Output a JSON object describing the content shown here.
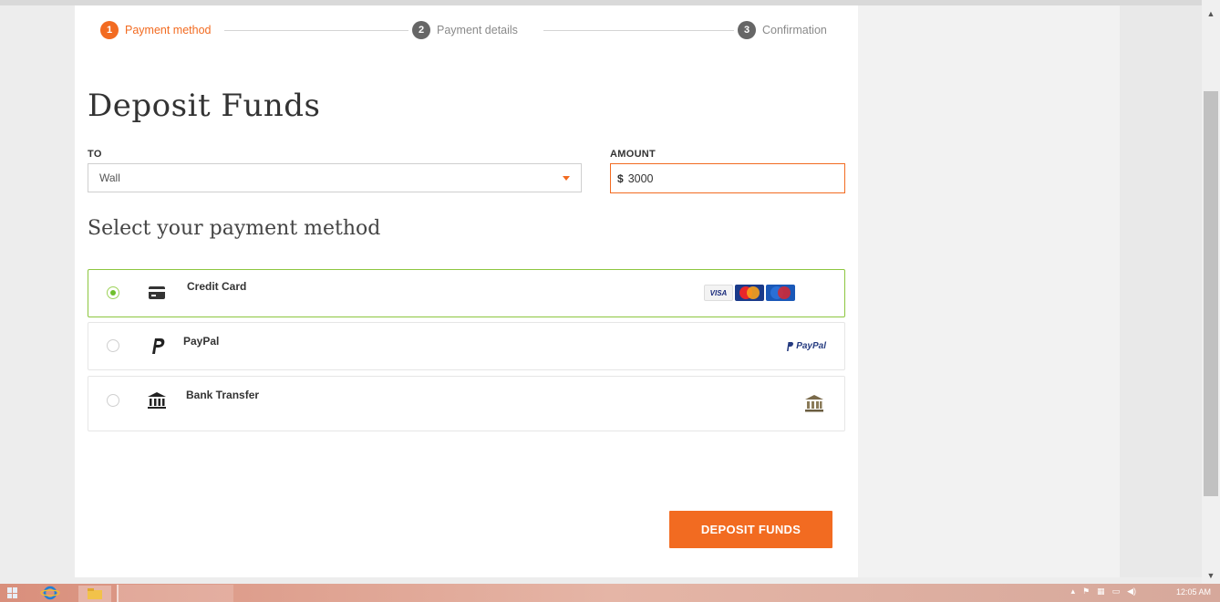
{
  "stepper": {
    "steps": [
      {
        "num": "1",
        "label": "Payment method",
        "active": true
      },
      {
        "num": "2",
        "label": "Payment details",
        "active": false
      },
      {
        "num": "3",
        "label": "Confirmation",
        "active": false
      }
    ]
  },
  "form": {
    "title": "Deposit Funds",
    "to_label": "TO",
    "to_value": "Wall",
    "amount_label": "AMOUNT",
    "amount_currency": "$",
    "amount_value": "3000",
    "payment_heading": "Select your payment method"
  },
  "methods": [
    {
      "name": "Credit Card",
      "selected": true,
      "icon": "credit-card-icon",
      "logos": [
        "VISA",
        "mastercard",
        "maestro"
      ]
    },
    {
      "name": "PayPal",
      "selected": false,
      "icon": "paypal-icon",
      "logo_text": "PayPal"
    },
    {
      "name": "Bank Transfer",
      "selected": false,
      "icon": "bank-icon"
    }
  ],
  "actions": {
    "deposit_label": "DEPOSIT FUNDS"
  },
  "taskbar": {
    "clock": "12:05 AM"
  },
  "colors": {
    "accent": "#f26b21",
    "selected_border": "#8dc63f",
    "step_inactive": "#666666"
  }
}
